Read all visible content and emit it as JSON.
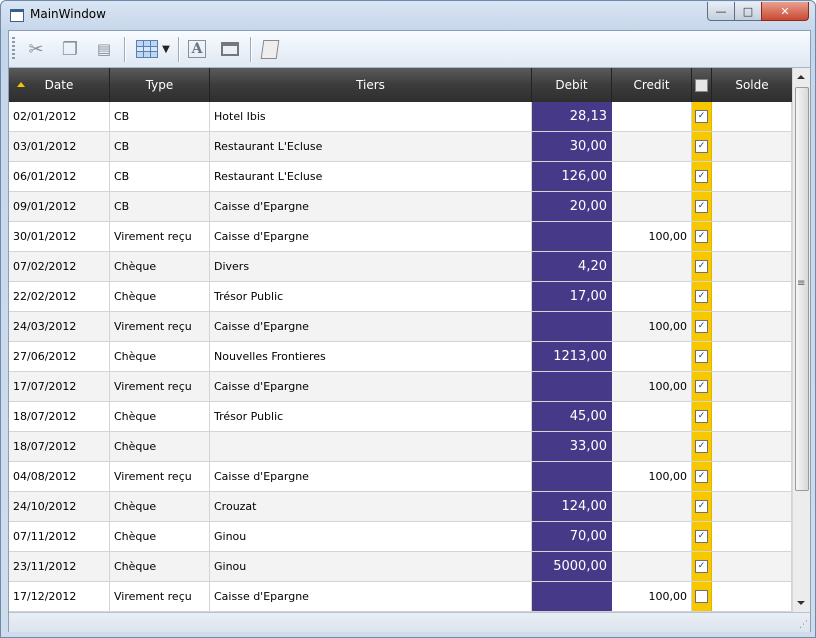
{
  "window": {
    "title": "MainWindow",
    "min_label": "—",
    "max_label": "□",
    "close_label": "✕"
  },
  "toolbar": {
    "buttons": [
      {
        "name": "cut-button",
        "icon": "scissors-icon",
        "glyph": "✂"
      },
      {
        "name": "copy-button",
        "icon": "copy-icon",
        "glyph": "❐"
      },
      {
        "name": "paste-button",
        "icon": "paste-icon",
        "glyph": "📋"
      },
      {
        "name": "grid-layout-button",
        "icon": "grid-icon"
      },
      {
        "name": "font-button",
        "icon": "font-icon",
        "glyph": "A"
      },
      {
        "name": "window-button",
        "icon": "window-icon",
        "glyph": "▭"
      },
      {
        "name": "print-button",
        "icon": "print-icon",
        "glyph": "🗎"
      }
    ]
  },
  "columns": {
    "date": "Date",
    "type": "Type",
    "tiers": "Tiers",
    "debit": "Debit",
    "credit": "Credit",
    "solde": "Solde"
  },
  "rows": [
    {
      "date": "02/01/2012",
      "type": "CB",
      "tiers": "Hotel Ibis",
      "debit": "28,13",
      "credit": "",
      "checked": true,
      "solde": ""
    },
    {
      "date": "03/01/2012",
      "type": "CB",
      "tiers": "Restaurant L'Ecluse",
      "debit": "30,00",
      "credit": "",
      "checked": true,
      "solde": ""
    },
    {
      "date": "06/01/2012",
      "type": "CB",
      "tiers": "Restaurant L'Ecluse",
      "debit": "126,00",
      "credit": "",
      "checked": true,
      "solde": ""
    },
    {
      "date": "09/01/2012",
      "type": "CB",
      "tiers": "Caisse d'Epargne",
      "debit": "20,00",
      "credit": "",
      "checked": true,
      "solde": ""
    },
    {
      "date": "30/01/2012",
      "type": "Virement reçu",
      "tiers": "Caisse d'Epargne",
      "debit": "",
      "credit": "100,00",
      "checked": true,
      "solde": ""
    },
    {
      "date": "07/02/2012",
      "type": "Chèque",
      "tiers": "Divers",
      "debit": "4,20",
      "credit": "",
      "checked": true,
      "solde": ""
    },
    {
      "date": "22/02/2012",
      "type": "Chèque",
      "tiers": "Trésor Public",
      "debit": "17,00",
      "credit": "",
      "checked": true,
      "solde": ""
    },
    {
      "date": "24/03/2012",
      "type": "Virement reçu",
      "tiers": "Caisse d'Epargne",
      "debit": "",
      "credit": "100,00",
      "checked": true,
      "solde": ""
    },
    {
      "date": "27/06/2012",
      "type": "Chèque",
      "tiers": "Nouvelles Frontieres",
      "debit": "1213,00",
      "credit": "",
      "checked": true,
      "solde": ""
    },
    {
      "date": "17/07/2012",
      "type": "Virement reçu",
      "tiers": "Caisse d'Epargne",
      "debit": "",
      "credit": "100,00",
      "checked": true,
      "solde": ""
    },
    {
      "date": "18/07/2012",
      "type": "Chèque",
      "tiers": "Trésor Public",
      "debit": "45,00",
      "credit": "",
      "checked": true,
      "solde": ""
    },
    {
      "date": "18/07/2012",
      "type": "Chèque",
      "tiers": "",
      "debit": "33,00",
      "credit": "",
      "checked": true,
      "solde": ""
    },
    {
      "date": "04/08/2012",
      "type": "Virement reçu",
      "tiers": "Caisse d'Epargne",
      "debit": "",
      "credit": "100,00",
      "checked": true,
      "solde": ""
    },
    {
      "date": "24/10/2012",
      "type": "Chèque",
      "tiers": "Crouzat",
      "debit": "124,00",
      "credit": "",
      "checked": true,
      "solde": ""
    },
    {
      "date": "07/11/2012",
      "type": "Chèque",
      "tiers": "Ginou",
      "debit": "70,00",
      "credit": "",
      "checked": true,
      "solde": ""
    },
    {
      "date": "23/11/2012",
      "type": "Chèque",
      "tiers": "Ginou",
      "debit": "5000,00",
      "credit": "",
      "checked": true,
      "solde": ""
    },
    {
      "date": "17/12/2012",
      "type": "Virement reçu",
      "tiers": "Caisse d'Epargne",
      "debit": "",
      "credit": "100,00",
      "checked": false,
      "solde": ""
    }
  ],
  "colors": {
    "debit_bg": "#463a88",
    "check_col_bg": "#f7c800",
    "sort_arrow": "#f5c400"
  }
}
